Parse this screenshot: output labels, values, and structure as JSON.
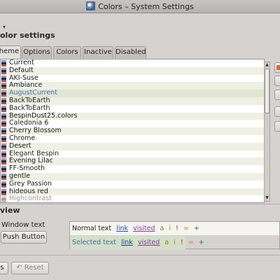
{
  "window": {
    "title": "Colors – System Settings"
  },
  "nav": {
    "back_glyph": "◁"
  },
  "page": {
    "heading": "olor settings"
  },
  "tabs": [
    {
      "label": "heme"
    },
    {
      "label": "Options"
    },
    {
      "label": "Colors"
    },
    {
      "label": "Inactive"
    },
    {
      "label": "Disabled"
    }
  ],
  "schemes": [
    "Current",
    "Default",
    "AKI-Suse",
    "Ambiance",
    "AugustCurrent",
    "BackToEarth",
    "BackToEarth",
    "BespinDust25.colors",
    "Caledonia 6",
    "Cherry Blossom",
    "Chrome",
    "Desert",
    "Elegant Bespin",
    "Evening Lilac",
    "FF-Smooth",
    "gentle",
    "Grey Passion",
    "hideous red",
    "Highcontrast"
  ],
  "selected_scheme": "AugustCurrent",
  "preview": {
    "heading": "view",
    "window_text": "Window text",
    "push_button": "Push Button",
    "normal_label": "Normal text",
    "selected_label": "Selected text",
    "link": "link",
    "visited": "visited",
    "active": "a",
    "inactive": "i",
    "negative": "!",
    "neutral": "=",
    "positive": "+"
  },
  "footer": {
    "left_btn": "s",
    "reset_btn": "Reset"
  }
}
